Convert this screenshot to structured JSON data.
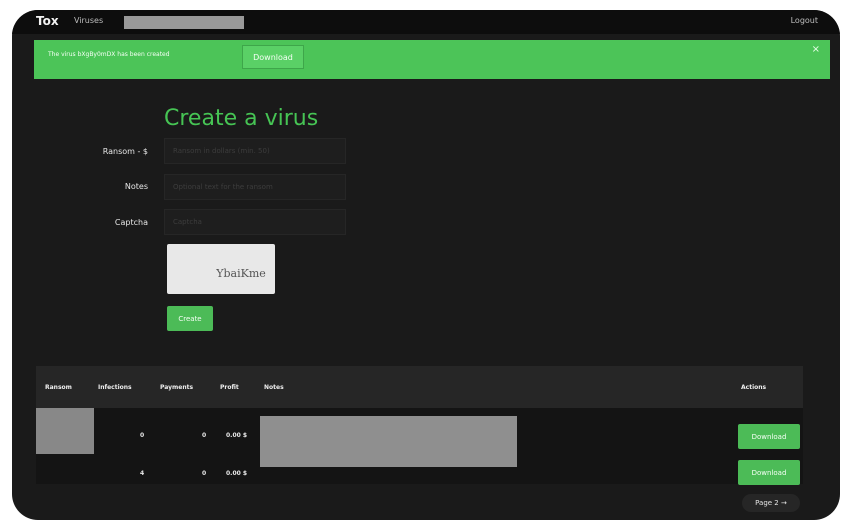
{
  "topbar": {
    "brand": "Tox",
    "nav_viruses": "Viruses",
    "logout": "Logout"
  },
  "alert": {
    "message": "The virus bXgBy0mDX has been created",
    "download": "Download",
    "close": "×"
  },
  "form": {
    "title": "Create a virus",
    "ransom_label": "Ransom - $",
    "ransom_placeholder": "Ransom in dollars (min. 50)",
    "notes_label": "Notes",
    "notes_placeholder": "Optional text for the ransom",
    "captcha_label": "Captcha",
    "captcha_placeholder": "Captcha",
    "captcha_image_text": "YbaiKme",
    "create_button": "Create"
  },
  "table": {
    "headers": [
      "Ransom",
      "Infections",
      "Payments",
      "Profit",
      "Notes",
      "Actions"
    ],
    "rows": [
      {
        "infections": "0",
        "payments": "0",
        "profit": "0.00 $",
        "action": "Download"
      },
      {
        "infections": "4",
        "payments": "0",
        "profit": "0.00 $",
        "action": "Download"
      }
    ]
  },
  "pagination": {
    "label": "Page 2 →"
  },
  "colors": {
    "accent_green": "#4cbb57",
    "background": "#1a1a1a"
  }
}
